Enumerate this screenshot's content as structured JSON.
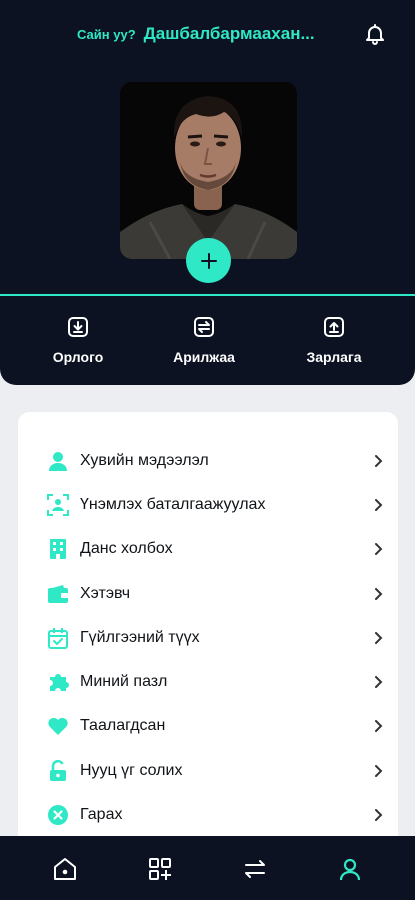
{
  "header": {
    "greeting": "Сайн уу?",
    "user_name": "Дашбалбармаахан..."
  },
  "actions": [
    {
      "label": "Орлого",
      "icon": "download-icon"
    },
    {
      "label": "Арилжаа",
      "icon": "exchange-icon"
    },
    {
      "label": "Зарлага",
      "icon": "upload-icon"
    }
  ],
  "menu": [
    {
      "label": "Хувийн мэдээлэл",
      "icon": "person-icon"
    },
    {
      "label": "Үнэмлэх баталгаажуулах",
      "icon": "id-scan-icon"
    },
    {
      "label": "Данс холбох",
      "icon": "building-icon"
    },
    {
      "label": "Хэтэвч",
      "icon": "wallet-icon"
    },
    {
      "label": "Гүйлгээний түүх",
      "icon": "calendar-check-icon"
    },
    {
      "label": "Миний пазл",
      "icon": "puzzle-icon"
    },
    {
      "label": "Таалагдсан",
      "icon": "heart-icon"
    },
    {
      "label": "Нууц үг солих",
      "icon": "unlock-icon"
    },
    {
      "label": "Гарах",
      "icon": "close-circle-icon"
    }
  ],
  "bottom_nav": [
    {
      "icon": "home-icon",
      "active": false
    },
    {
      "icon": "apps-add-icon",
      "active": false
    },
    {
      "icon": "transfer-icon",
      "active": false
    },
    {
      "icon": "profile-icon",
      "active": true
    }
  ],
  "colors": {
    "accent": "#2ee8c6",
    "dark": "#0c1221",
    "background": "#eceef1"
  }
}
